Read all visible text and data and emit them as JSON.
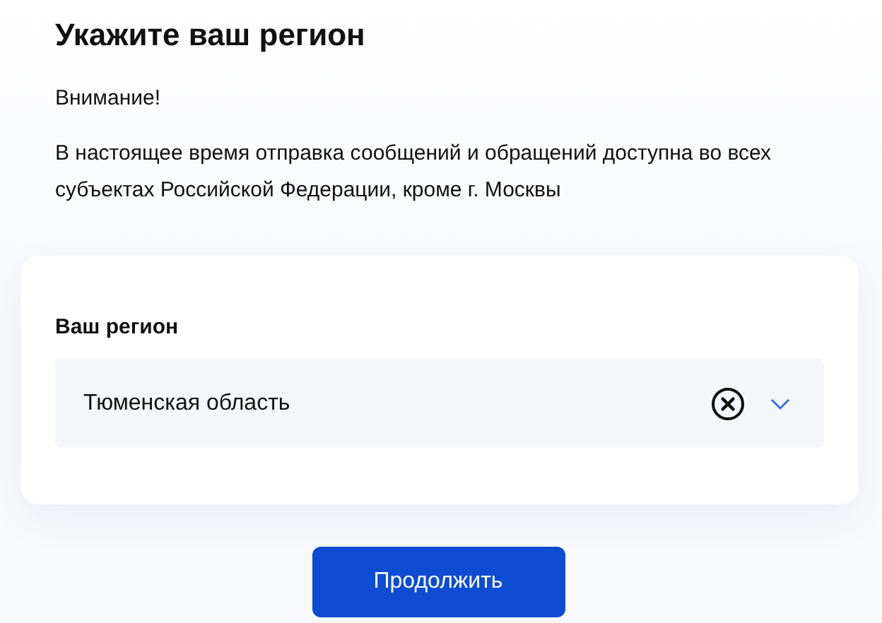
{
  "title": "Укажите ваш регион",
  "notice": "Внимание!",
  "message": "В настоящее время отправка сообщений и обращений доступна во всех субъектах Российской Федерации, кроме г. Москвы",
  "region_field": {
    "label": "Ваш регион",
    "value": "Тюменская область"
  },
  "continue_button": "Продолжить"
}
